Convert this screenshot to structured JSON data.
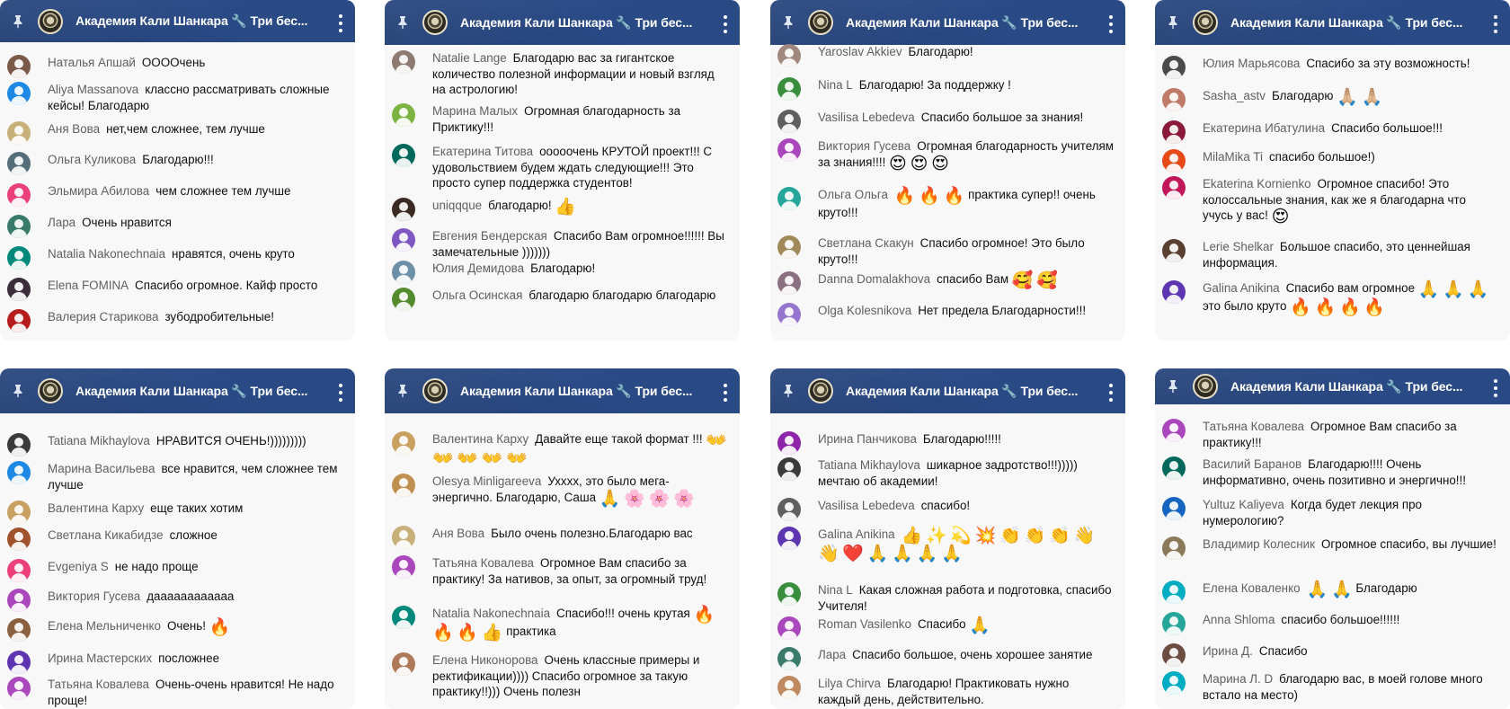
{
  "channel": {
    "title": "Академия Кали Шанкара 🔧 Три бес..."
  },
  "colors": {
    "header": "#2a4a86",
    "author": "#606060",
    "text": "#0f0f0f"
  },
  "panels": [
    {
      "messages": [
        {
          "author": "Наталья Апшай",
          "text": "ООООчень",
          "avatar": "#7b5a4a"
        },
        {
          "author": "Aliya Massanova",
          "text": "классно рассматривать сложные кейсы! Благодарю",
          "avatar": "#1e88e5"
        },
        {
          "author": "Аня Вова",
          "text": "нет,чем сложнее, тем лучше",
          "avatar": "#c8b07a"
        },
        {
          "author": "Ольга Куликова",
          "text": "Благодарю!!!",
          "avatar": "#546e7a"
        },
        {
          "author": "Эльмира Абилова",
          "text": "чем сложнее тем лучше",
          "avatar": "#ec407a"
        },
        {
          "author": "Лара",
          "text": "Очень нравится",
          "avatar": "#3a7a6a"
        },
        {
          "author": "Natalia Nakonechnaia",
          "text": "нравятся, очень круто",
          "avatar": "#00897b"
        },
        {
          "author": "Elena FOMINA",
          "text": "Спасибо огромное. Кайф просто",
          "avatar": "#3b2d3a"
        },
        {
          "author": "Валерия Старикова",
          "text": "зубодробительные!",
          "avatar": "#b71c1c"
        }
      ]
    },
    {
      "messages": [
        {
          "author": "Natalie Lange",
          "text": "Благодарю вас за гигантское количество полезной информации и новый взгляд на астрологию!",
          "avatar": "#8d7a70"
        },
        {
          "author": "Марина Малых",
          "text": "Огромная благодарность за Приктику!!!",
          "avatar": "#7cb342"
        },
        {
          "author": "Екатерина Титова",
          "text": "ооооочень КРУТОЙ проект!!! С удовольствием будем ждать следующие!!! Это просто супер поддержка студентов!",
          "avatar": "#00695c"
        },
        {
          "author": "uniqqque",
          "text": "благодарю! 👍",
          "avatar": "#3a2a22"
        },
        {
          "author": "Евгения Бендерская",
          "text": "Спасибо Вам огромное!!!!!! Вы замечательные )))))))",
          "avatar": "#7e57c2"
        },
        {
          "author": "Юлия Демидова",
          "text": "Благодарю!",
          "avatar": "#6d8fa8"
        },
        {
          "author": "Ольга Осинская",
          "text": "благодарю благодарю благодарю",
          "avatar": "#558b2f"
        }
      ]
    },
    {
      "messages": [
        {
          "author": "Yaroslav Akkiev",
          "text": "Благодарю!",
          "avatar": "#a1887f"
        },
        {
          "author": "Nina L",
          "text": "Благодарю! За поддержку !",
          "avatar": "#388e3c"
        },
        {
          "author": "Vasilisa Lebedeva",
          "text": "Спасибо большое за знания!",
          "avatar": "#5f5f5f"
        },
        {
          "author": "Виктория Гусева",
          "text": "Огромная благодарность учителям за знания!!!! 😍 😍 😍",
          "avatar": "#ab47bc"
        },
        {
          "author": "Ольга Ольга",
          "text": "🔥 🔥 🔥 практика супер!! очень круто!!!",
          "avatar": "#26a69a"
        },
        {
          "author": "Светлана Скакун",
          "text": "Спасибо огромное! Это было круто!!!",
          "avatar": "#a08a5a"
        },
        {
          "author": "Danna Domalakhova",
          "text": "спасибо Вам 🥰 🥰",
          "avatar": "#8a7080"
        },
        {
          "author": "Olga Kolesnikova",
          "text": "Нет предела Благодарности!!!",
          "avatar": "#9575cd"
        }
      ]
    },
    {
      "messages": [
        {
          "author": "Юлия Марьясова",
          "text": "Спасибо за эту возможность!",
          "avatar": "#4a4a4a"
        },
        {
          "author": "Sasha_astv",
          "text": "Благодарю 🙏🏼 🙏🏼",
          "avatar": "#c07a6a"
        },
        {
          "author": "Екатерина Ибатулина",
          "text": "Спасибо большое!!!",
          "avatar": "#8a1a3a"
        },
        {
          "author": "MilaMika Ti",
          "text": "спасибо большое!)",
          "avatar": "#e64a19"
        },
        {
          "author": "Ekaterina Kornienko",
          "text": "Огромное спасибо! Это колоссальные знания, как же я благодарна что учусь у вас! 😍",
          "avatar": "#c2185b"
        },
        {
          "author": "Lerie Shelkar",
          "text": "Большое спасибо, это ценнейшая информация.",
          "avatar": "#5a4030"
        },
        {
          "author": "Galina Anikina",
          "text": "Спасибо вам огромное 🙏 🙏 🙏 это было круто 🔥 🔥 🔥 🔥",
          "avatar": "#5e35b1"
        }
      ]
    },
    {
      "messages": [
        {
          "author": "Tatiana Mikhaylova",
          "text": "НРАВИТСЯ ОЧЕНЬ!)))))))))",
          "avatar": "#3a3a3a"
        },
        {
          "author": "Марина Васильева",
          "text": "все нравится, чем сложнее тем лучше",
          "avatar": "#1e88e5"
        },
        {
          "author": "Валентина Карху",
          "text": "еще таких хотим",
          "avatar": "#c8a060"
        },
        {
          "author": "Светлана Кикабидзе",
          "text": "сложное",
          "avatar": "#a0522d"
        },
        {
          "author": "Evgeniya S",
          "text": "не надо проще",
          "avatar": "#ec407a"
        },
        {
          "author": "Виктория Гусева",
          "text": "даааааааааааа",
          "avatar": "#ab47bc"
        },
        {
          "author": "Елена Мельниченко",
          "text": "Очень! 🔥",
          "avatar": "#8a6040"
        },
        {
          "author": "Ирина Мастерских",
          "text": "посложнее",
          "avatar": "#5e35b1"
        },
        {
          "author": "Татьяна Ковалева",
          "text": "Очень-очень нравится! Не надо проще!",
          "avatar": "#ab47bc"
        }
      ]
    },
    {
      "messages": [
        {
          "author": "Валентина Карху",
          "text": "Давайте еще такой формат !!! 👐 👐 👐 👐 👐",
          "avatar": "#c8a060"
        },
        {
          "author": "Olesya Minligareeva",
          "text": "Ухххх, это было мега-энергично. Благодарю, Саша 🙏 🌸 🌸 🌸",
          "avatar": "#c09050"
        },
        {
          "author": "Аня Вова",
          "text": "Было очень полезно.Благодарю вас",
          "avatar": "#c8b07a"
        },
        {
          "author": "Татьяна Ковалева",
          "text": "Огромное Вам спасибо за практику! За нативов, за опыт, за огромный труд!",
          "avatar": "#ab47bc"
        },
        {
          "author": "Natalia Nakonechnaia",
          "text": "Спасибо!!! очень крутая 🔥 🔥 🔥 👍 практика",
          "avatar": "#00897b"
        },
        {
          "author": "Елена Никонорова",
          "text": "Очень классные примеры и ректификации)))) Спасибо огромное за такую практику!!))) Очень полезн",
          "avatar": "#b07a5a"
        }
      ]
    },
    {
      "messages": [
        {
          "author": "Ирина Панчикова",
          "text": "Благодарю!!!!!",
          "avatar": "#8e24aa"
        },
        {
          "author": "Tatiana Mikhaylova",
          "text": "шикарное задротство!!!))))) мечтаю об академии!",
          "avatar": "#3a3a3a"
        },
        {
          "author": "Vasilisa Lebedeva",
          "text": "спасибо!",
          "avatar": "#5f5f5f"
        },
        {
          "author": "Galina Anikina",
          "text": "👍 ✨ 💫 💥 👏 👏 👏 👋 👋 ❤️ 🙏 🙏 🙏 🙏",
          "avatar": "#5e35b1"
        },
        {
          "author": "Nina L",
          "text": "Какая сложная работа и подготовка, спасибо Учителя!",
          "avatar": "#388e3c"
        },
        {
          "author": "Roman Vasilenko",
          "text": "Спасибо 🙏",
          "avatar": "#ab47bc"
        },
        {
          "author": "Лара",
          "text": "Спасибо большое, очень хорошее занятие",
          "avatar": "#3a7a6a"
        },
        {
          "author": "Lilya Chirva",
          "text": "Благодарю! Практиковать нужно каждый день, действительно.",
          "avatar": "#c08a60"
        }
      ]
    },
    {
      "messages": [
        {
          "author": "Татьяна Ковалева",
          "text": "Огромное Вам спасибо за практику!!!",
          "avatar": "#ab47bc"
        },
        {
          "author": "Василий Баранов",
          "text": "Благодарю!!!! Очень информативно, очень позитивно и энергично!!!",
          "avatar": "#00695c"
        },
        {
          "author": "Yultuz Kaliyeva",
          "text": "Когда будет лекция про нумерологию?",
          "avatar": "#1565c0"
        },
        {
          "author": "Владимир Колесник",
          "text": "Огромное спасибо, вы лучшие!",
          "avatar": "#8a7a5a"
        },
        {
          "author": "Елена Коваленко",
          "text": "🙏 🙏 Благодарю",
          "avatar": "#00acc1"
        },
        {
          "author": "Anna Shloma",
          "text": "спасибо большое!!!!!!",
          "avatar": "#26a69a"
        },
        {
          "author": "Ирина Д.",
          "text": "Спасибо",
          "avatar": "#6d4c41"
        },
        {
          "author": "Марина Л. D",
          "text": "благодарю вас, в моей голове много встало на место)",
          "avatar": "#00acc1"
        }
      ]
    }
  ]
}
